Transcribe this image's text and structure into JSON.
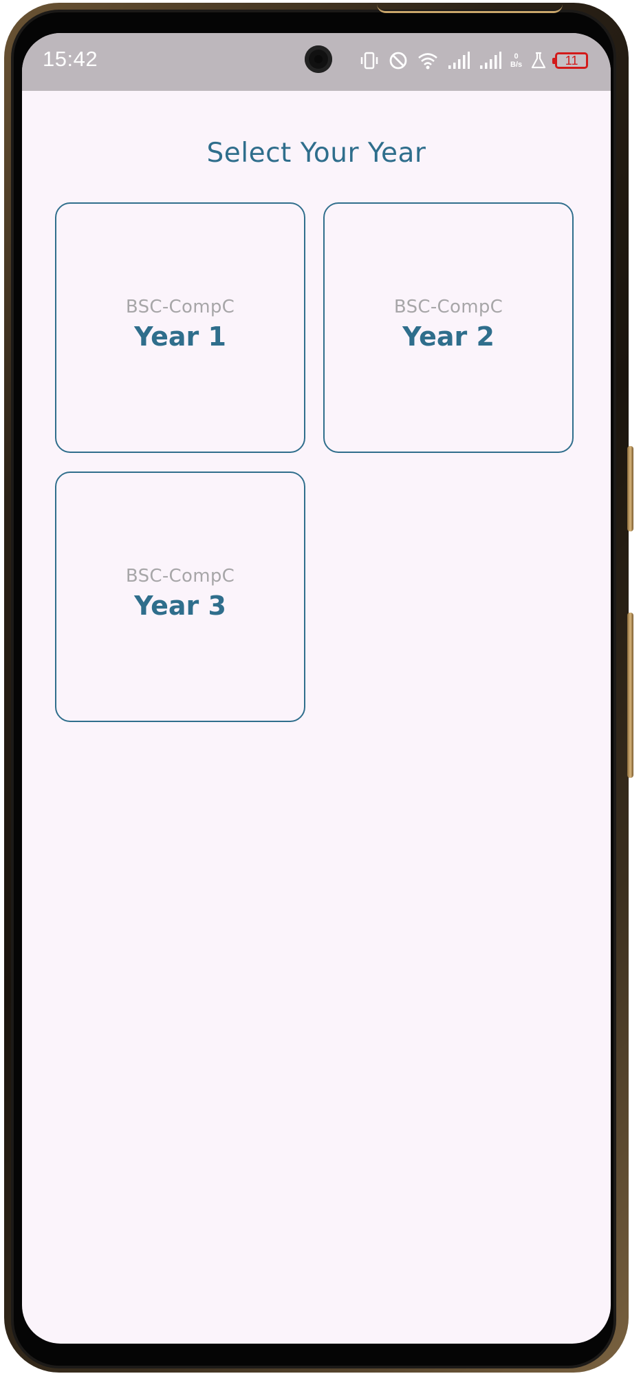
{
  "status_bar": {
    "time": "15:42",
    "net_speed_value": "0",
    "net_speed_unit": "B/s",
    "battery_level": "11",
    "icons": [
      "vibrate-icon",
      "do-not-disturb-icon",
      "wifi-icon",
      "signal-icon",
      "signal-icon",
      "lab-flask-icon",
      "battery-icon"
    ],
    "battery_color": "#d21a1a"
  },
  "page": {
    "title": "Select Your Year"
  },
  "years": [
    {
      "course": "BSC-CompC",
      "label": "Year 1"
    },
    {
      "course": "BSC-CompC",
      "label": "Year 2"
    },
    {
      "course": "BSC-CompC",
      "label": "Year 3"
    }
  ],
  "colors": {
    "accent": "#2f6e8c",
    "subtext": "#a7a6a8",
    "background": "#fbf4fb",
    "status_bar": "#bdb7bc"
  }
}
